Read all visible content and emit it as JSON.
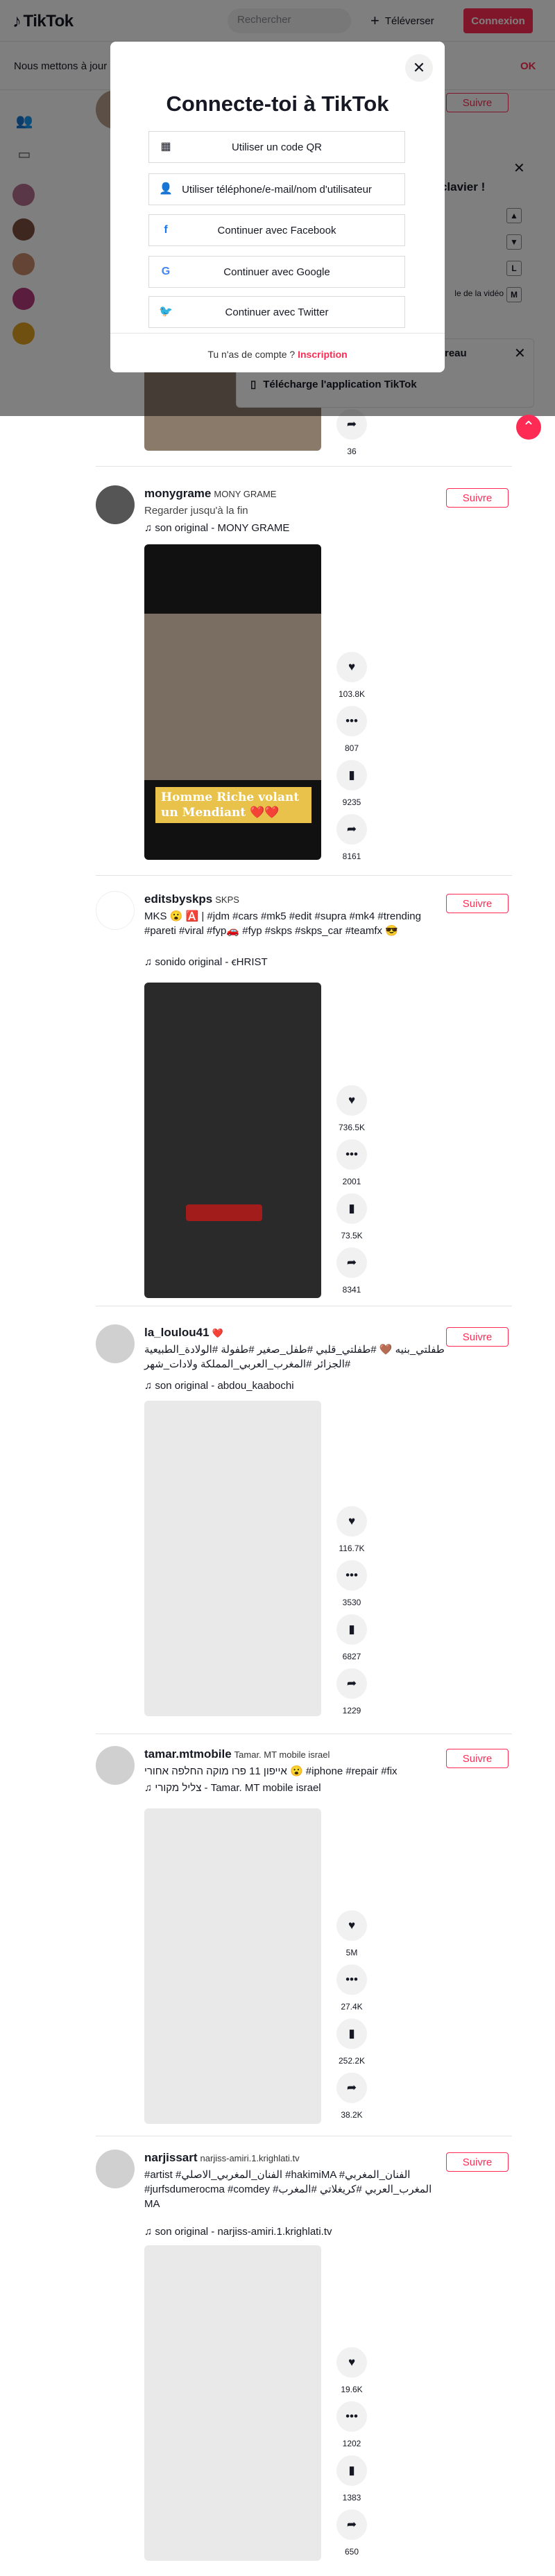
{
  "header": {
    "logo": "TikTok",
    "search_placeholder": "Rechercher",
    "upload_label": "Téléverser",
    "login_label": "Connexion"
  },
  "cookie_banner": {
    "text": "Nous mettons à jour",
    "ok_label": "OK"
  },
  "modal": {
    "title": "Connecte-toi à TikTok",
    "close_icon": "close-icon",
    "options": [
      {
        "icon": "qr-code-icon",
        "label": "Utiliser un code QR"
      },
      {
        "icon": "person-icon",
        "label": "Utiliser téléphone/e-mail/nom d'utilisateur"
      },
      {
        "icon": "facebook-icon",
        "label": "Continuer avec Facebook"
      },
      {
        "icon": "google-icon",
        "label": "Continuer avec Google"
      },
      {
        "icon": "twitter-icon",
        "label": "Continuer avec Twitter"
      }
    ],
    "footer_text": "Tu n'as de compte ?",
    "footer_link": "Inscription"
  },
  "keyboard_panel": {
    "title": "rcis clavier !",
    "rows": [
      "",
      "",
      "",
      "le de la vidéo"
    ],
    "keys": [
      "▲",
      "▼",
      "L",
      "M"
    ]
  },
  "desktop_panel": {
    "title": "de bureau",
    "link": "Télécharge l'application TikTok"
  },
  "posts": [
    {
      "username": "",
      "nickname": "",
      "description": "",
      "music": "",
      "follow_label": "Suivre",
      "likes": "",
      "comments": "",
      "saves": "",
      "shares": "36"
    },
    {
      "username": "monygrame",
      "nickname": "MONY GRAME",
      "description": "Regarder jusqu'à la fin",
      "music": "son original - MONY GRAME",
      "follow_label": "Suivre",
      "video_caption": "Homme Riche volant un Mendiant ❤️❤️",
      "likes": "103.8K",
      "comments": "807",
      "saves": "9235",
      "shares": "8161"
    },
    {
      "username": "editsbyskps",
      "nickname": "SKPS",
      "description": "MKS 😮 🅰️ | #jdm #cars #mk5 #edit #supra #mk4 #trending #pareti #viral #fyp🚗 #fyp #skps #skps_car #teamfx 😎",
      "music": "sonido original - ꞓHRIST",
      "follow_label": "Suivre",
      "likes": "736.5K",
      "comments": "2001",
      "saves": "73.5K",
      "shares": "8341"
    },
    {
      "username": "la_loulou41",
      "nickname": "❤️",
      "description": "طفلتي_بنيه 🤎 #طفلتي_قلبي #طفل_صغير #طفولة #الولادة_الطبيعية #الجزائر #المغرب_العربي_المملكة ولادات_شهر",
      "music": "son original - abdou_kaabochi",
      "follow_label": "Suivre",
      "likes": "116.7K",
      "comments": "3530",
      "saves": "6827",
      "shares": "1229"
    },
    {
      "username": "tamar.mtmobile",
      "nickname": "Tamar. MT mobile israel",
      "description": "אייפון 11 פרו מוקה החלפה אחורי 😮 #iphone #repair #fix",
      "music": "צליל מקורי - Tamar. MT mobile israel",
      "follow_label": "Suivre",
      "likes": "5M",
      "comments": "27.4K",
      "saves": "252.2K",
      "shares": "38.2K"
    },
    {
      "username": "narjissart",
      "nickname": "narjiss-amiri.1.krighlati.tv",
      "description": "#artist #الفنان_المغربي_الاصلي #hakimiMA #الفنان_المغربي #jurfsdumerocma #comdey #المغرب_العربي #كريغلاتي #المغرب MA",
      "music": "son original - narjiss-amiri.1.krighlati.tv",
      "follow_label": "Suivre",
      "likes": "19.6K",
      "comments": "1202",
      "saves": "1383",
      "shares": "650"
    }
  ]
}
